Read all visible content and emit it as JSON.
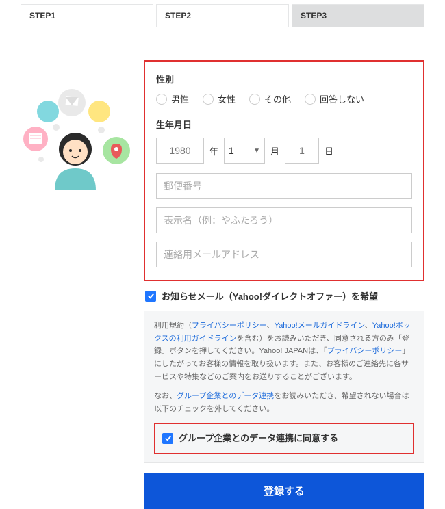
{
  "steps": {
    "s1": "STEP1",
    "s2": "STEP2",
    "s3": "STEP3"
  },
  "form": {
    "gender_label": "性別",
    "gender_opts": {
      "male": "男性",
      "female": "女性",
      "other": "その他",
      "none": "回答しない"
    },
    "dob_label": "生年月日",
    "year_placeholder": "1980",
    "year_unit": "年",
    "month_value": "1",
    "month_unit": "月",
    "day_placeholder": "1",
    "day_unit": "日",
    "zip_placeholder": "郵便番号",
    "display_name_placeholder": "表示名（例：やふたろう）",
    "contact_email_placeholder": "連絡用メールアドレス"
  },
  "newsletter_label": "お知らせメール（Yahoo!ダイレクトオファー）を希望",
  "terms": {
    "t1a": "利用規約（",
    "l1": "プライバシーポリシー",
    "sep1": "、",
    "l2": "Yahoo!メールガイドライン",
    "sep2": "、",
    "l3": "Yahoo!ボックスの利用ガイドライン",
    "t1b": "を含む）をお読みいただき、同意される方のみ「登録」ボタンを押してください。Yahoo! JAPANは、「",
    "l4": "プライバシーポリシー",
    "t1c": "」にしたがってお客様の情報を取り扱います。また、お客様のご連絡先に各サービスや特集などのご案内をお送りすることがございます。",
    "t2a": "なお、",
    "l5": "グループ企業とのデータ連携",
    "t2b": "をお読みいただき、希望されない場合は以下のチェックを外してください。"
  },
  "consent_label": "グループ企業とのデータ連携に同意する",
  "submit_label": "登録する"
}
